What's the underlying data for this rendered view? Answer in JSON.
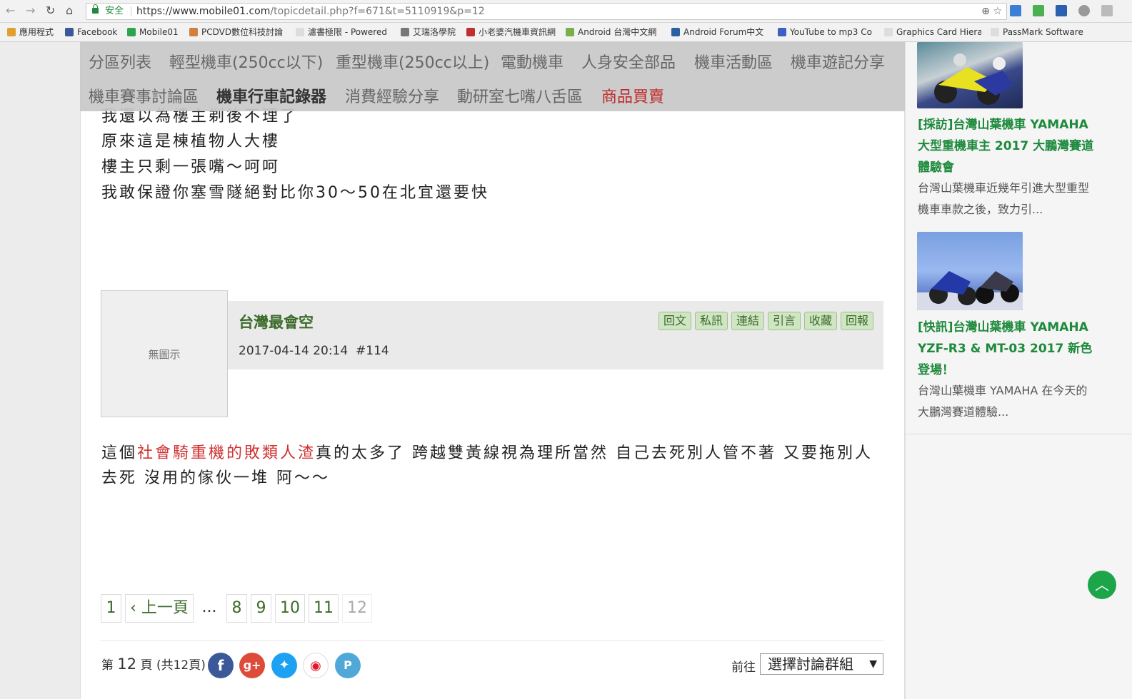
{
  "browser": {
    "security_label": "安全",
    "url_host": "https://www.mobile01.com",
    "url_path": "/topicdetail.php?f=671&t=5110919&p=12"
  },
  "bookmarks": [
    {
      "label": "應用程式",
      "color": "#e0a030"
    },
    {
      "label": "Facebook",
      "color": "#3b5998"
    },
    {
      "label": "Mobile01",
      "color": "#2ea44f"
    },
    {
      "label": "PCDVD數位科技討論",
      "color": "#d08040"
    },
    {
      "label": "濾書極限 - Powered",
      "color": "#aaaaaa"
    },
    {
      "label": "艾瑞洛學院",
      "color": "#777777"
    },
    {
      "label": "小老婆汽機車資訊網",
      "color": "#c03030"
    },
    {
      "label": "Android 台灣中文網",
      "color": "#7ab04c"
    },
    {
      "label": "Android Forum中文",
      "color": "#2a5fa0"
    },
    {
      "label": "YouTube to mp3 Co",
      "color": "#4060c0"
    },
    {
      "label": "Graphics Card Hiera",
      "color": "#aaaaaa"
    },
    {
      "label": "PassMark Software",
      "color": "#aaaaaa"
    }
  ],
  "menu": {
    "row1": [
      "分區列表",
      "輕型機車(250cc以下)",
      "重型機車(250cc以上)",
      "電動機車",
      "人身安全部品",
      "機車活動區",
      "機車遊記分享"
    ],
    "row2": [
      "機車賽事討論區",
      "機車行車記錄器",
      "消費經驗分享",
      "動研室七嘴八舌區",
      "商品買賣"
    ]
  },
  "prev_post": {
    "lines": [
      "我還以為樓主剃後不理了",
      "原來這是棟植物人大樓",
      "樓主只剩一張嘴～呵呵",
      "我敢保證你塞雪隧絕對比你30～50在北宜還要快"
    ]
  },
  "post": {
    "avatar_text": "無圖示",
    "username": "台灣最會空",
    "date": "2017-04-14 20:14",
    "number": "#114",
    "buttons": [
      "回文",
      "私訊",
      "連結",
      "引言",
      "收藏",
      "回報"
    ],
    "body_pre": "這個",
    "body_highlight": "社會騎重機的敗類人渣",
    "body_post": "真的太多了 跨越雙黃線視為理所當然 自己去死別人管不著 又要拖別人去死 沒用的傢伙一堆 阿～～"
  },
  "pagination": {
    "items": [
      "1",
      "‹ 上一頁",
      "...",
      "8",
      "9",
      "10",
      "11",
      "12"
    ],
    "current": "12"
  },
  "footer": {
    "page_prefix": "第",
    "page_num": "12",
    "page_suffix": "頁 (共12頁)",
    "goto_label": "前往",
    "select_value": "選擇討論群組",
    "social": [
      "facebook-icon",
      "google-plus-icon",
      "twitter-icon",
      "weibo-icon",
      "plurk-icon"
    ]
  },
  "sidebar": {
    "articles": [
      {
        "title": "[採訪]台灣山葉機車 YAMAHA 大型重機車主 2017 大鵬灣賽道體驗會",
        "desc": "台灣山葉機車近幾年引進大型重型機車車款之後，致力引..."
      },
      {
        "title": "[快訊]台灣山葉機車 YAMAHA YZF-R3 & MT-03 2017 新色登場！",
        "desc": "台灣山葉機車 YAMAHA 在今天的大鵬灣賽道體驗..."
      }
    ]
  }
}
